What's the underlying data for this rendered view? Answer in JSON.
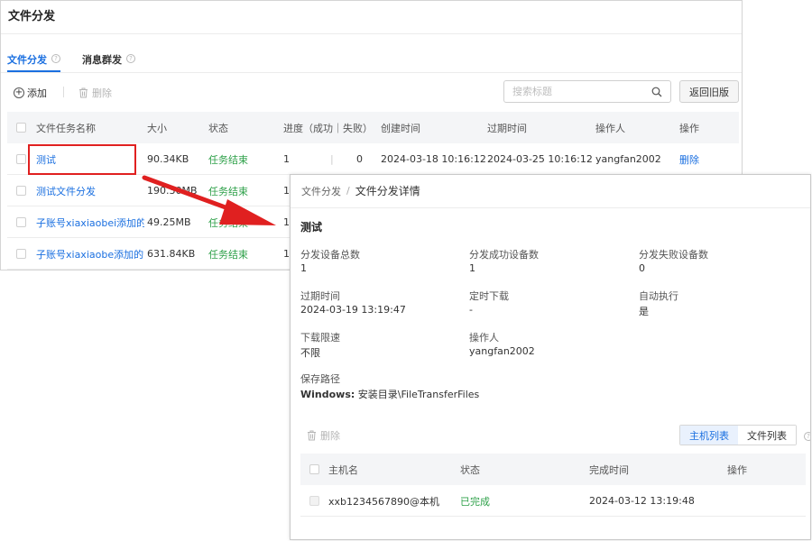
{
  "back": {
    "title": "文件分发",
    "tabs": [
      {
        "label": "文件分发",
        "active": true
      },
      {
        "label": "消息群发",
        "active": false
      }
    ],
    "toolbar": {
      "add_label": "添加",
      "delete_label": "删除",
      "search_placeholder": "搜索标题",
      "return_label": "返回旧版"
    },
    "columns": {
      "name": "文件任务名称",
      "size": "大小",
      "status": "状态",
      "progress": "进度（成功｜失败）",
      "created": "创建时间",
      "expires": "过期时间",
      "operator": "操作人",
      "action": "操作"
    },
    "rows": [
      {
        "name": "测试",
        "size": "90.34KB",
        "status": "任务结束",
        "success": "1",
        "fail": "0",
        "created": "2024-03-18 10:16:12",
        "expires": "2024-03-25 10:16:12",
        "operator": "yangfan2002",
        "action": "删除"
      },
      {
        "name": "测试文件分发",
        "size": "190.30MB",
        "status": "任务结束",
        "success": "1"
      },
      {
        "name": "子账号xiaxiaobei添加的",
        "size": "49.25MB",
        "status": "任务结束",
        "success": "1"
      },
      {
        "name": "子账号xiaxiaobe添加的",
        "size": "631.84KB",
        "status": "任务结束",
        "success": "1"
      }
    ]
  },
  "detail": {
    "breadcrumb_parent": "文件分发",
    "breadcrumb_sep": "/",
    "breadcrumb_current": "文件分发详情",
    "title": "测试",
    "fields": {
      "total_label": "分发设备总数",
      "total_value": "1",
      "success_label": "分发成功设备数",
      "success_value": "1",
      "fail_label": "分发失败设备数",
      "fail_value": "0",
      "expire_label": "过期时间",
      "expire_value": "2024-03-19 13:19:47",
      "scheduled_label": "定时下载",
      "scheduled_value": "-",
      "auto_label": "自动执行",
      "auto_value": "是",
      "speed_label": "下载限速",
      "speed_value": "不限",
      "operator_label": "操作人",
      "operator_value": "yangfan2002",
      "path_label": "保存路径",
      "path_os": "Windows:",
      "path_value": "安装目录\\FileTransferFiles"
    },
    "delete_label": "删除",
    "segments": [
      "主机列表",
      "文件列表"
    ],
    "columns": {
      "host": "主机名",
      "status": "状态",
      "done_time": "完成时间",
      "action": "操作"
    },
    "rows": [
      {
        "host": "xxb1234567890@本机",
        "status": "已完成",
        "done_time": "2024-03-12 13:19:48"
      }
    ]
  },
  "colors": {
    "accent": "#1a6fe0",
    "success": "#2fa14a",
    "highlight": "#e02020"
  }
}
